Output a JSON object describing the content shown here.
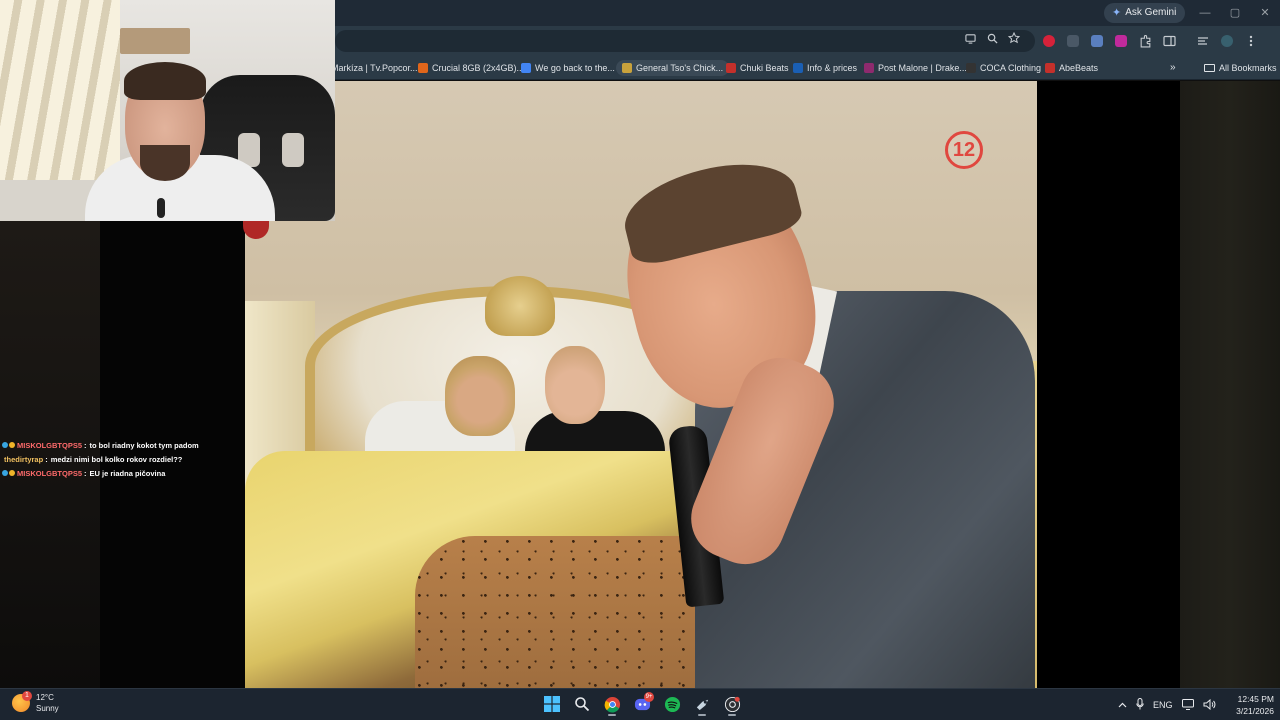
{
  "browser": {
    "ask_gemini_label": "Ask Gemini",
    "window_controls": {
      "minimize": "—",
      "maximize": "▢",
      "close": "✕"
    },
    "bookmarks": [
      {
        "label": "Markíza | Tv.Popcor...",
        "color": "#3b8a3e"
      },
      {
        "label": "Crucial 8GB (2x4GB)...",
        "color": "#e0661b"
      },
      {
        "label": "We go back to the...",
        "color": "#4285f4"
      },
      {
        "label": "General Tso's Chick...",
        "color": "#c9a23c"
      },
      {
        "label": "Chuki Beats",
        "color": "#c4302b"
      },
      {
        "label": "Info & prices",
        "color": "#1a5fb4"
      },
      {
        "label": "Post Malone | Drake...",
        "color": "#8e2a6e"
      },
      {
        "label": "COCA Clothing",
        "color": "#333333"
      },
      {
        "label": "AbeBeats",
        "color": "#c4302b"
      }
    ],
    "bookmarks_more": "»",
    "all_bookmarks_label": "All Bookmarks"
  },
  "video": {
    "channel_logo_text": "12"
  },
  "chat": {
    "messages": [
      {
        "user": "MISKOLGBTQPS5",
        "user_color": "#ff6b6b",
        "text": "to bol riadny kokot tym padom"
      },
      {
        "user": "thedirtyrap",
        "user_color": "#f0c060",
        "text": "medzi nimi bol kolko rokov rozdiel??"
      },
      {
        "user": "MISKOLGBTQPS5",
        "user_color": "#ff6b6b",
        "text": "EU je riadna pičovina"
      }
    ]
  },
  "taskbar": {
    "weather_temp": "12°C",
    "weather_cond": "Sunny",
    "weather_badge": "1",
    "discord_badge": "9+",
    "tray_language": "ENG",
    "clock_time": "12:45 PM",
    "clock_date": "3/21/2026"
  }
}
